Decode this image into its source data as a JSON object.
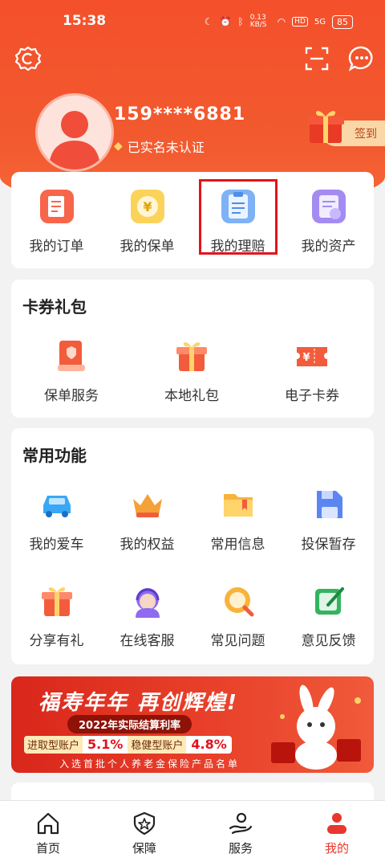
{
  "status_bar": {
    "time": "15:38",
    "net_speed": "0.13 KB/S",
    "hd": "HD",
    "signal": "5G",
    "battery": "85"
  },
  "header": {
    "phone": "159****6881",
    "verify_status": "已实名未认证",
    "checkin_label": "签到"
  },
  "top_shortcuts": [
    {
      "label": "我的订单",
      "icon": "order-icon"
    },
    {
      "label": "我的保单",
      "icon": "policy-coin-icon"
    },
    {
      "label": "我的理赔",
      "icon": "claim-doc-icon"
    },
    {
      "label": "我的资产",
      "icon": "asset-doc-icon"
    }
  ],
  "coupons": {
    "title": "卡券礼包",
    "items": [
      {
        "label": "保单服务",
        "icon": "policy-service-icon"
      },
      {
        "label": "本地礼包",
        "icon": "local-gift-icon"
      },
      {
        "label": "电子卡券",
        "icon": "e-coupon-icon"
      }
    ]
  },
  "functions": {
    "title": "常用功能",
    "items": [
      {
        "label": "我的爱车",
        "icon": "car-icon"
      },
      {
        "label": "我的权益",
        "icon": "crown-icon"
      },
      {
        "label": "常用信息",
        "icon": "folder-icon"
      },
      {
        "label": "投保暂存",
        "icon": "save-icon"
      },
      {
        "label": "分享有礼",
        "icon": "share-gift-icon"
      },
      {
        "label": "在线客服",
        "icon": "service-agent-icon"
      },
      {
        "label": "常见问题",
        "icon": "faq-icon"
      },
      {
        "label": "意见反馈",
        "icon": "feedback-icon"
      }
    ]
  },
  "banner": {
    "headline": "福寿年年 再创辉煌!",
    "subline": "2022年实际结算利率",
    "account1_label": "进取型账户",
    "account1_rate": "5.1%",
    "account2_label": "稳健型账户",
    "account2_rate": "4.8%",
    "footnote": "入选首批个人养老金保险产品名单"
  },
  "tabbar": [
    {
      "label": "首页",
      "icon": "home-icon"
    },
    {
      "label": "保障",
      "icon": "shield-star-icon"
    },
    {
      "label": "服务",
      "icon": "service-hand-icon"
    },
    {
      "label": "我的",
      "icon": "profile-icon",
      "active": true
    }
  ],
  "colors": {
    "brand": "#f4502b",
    "active_tab": "#e8372d",
    "highlight": "#e3141b"
  }
}
